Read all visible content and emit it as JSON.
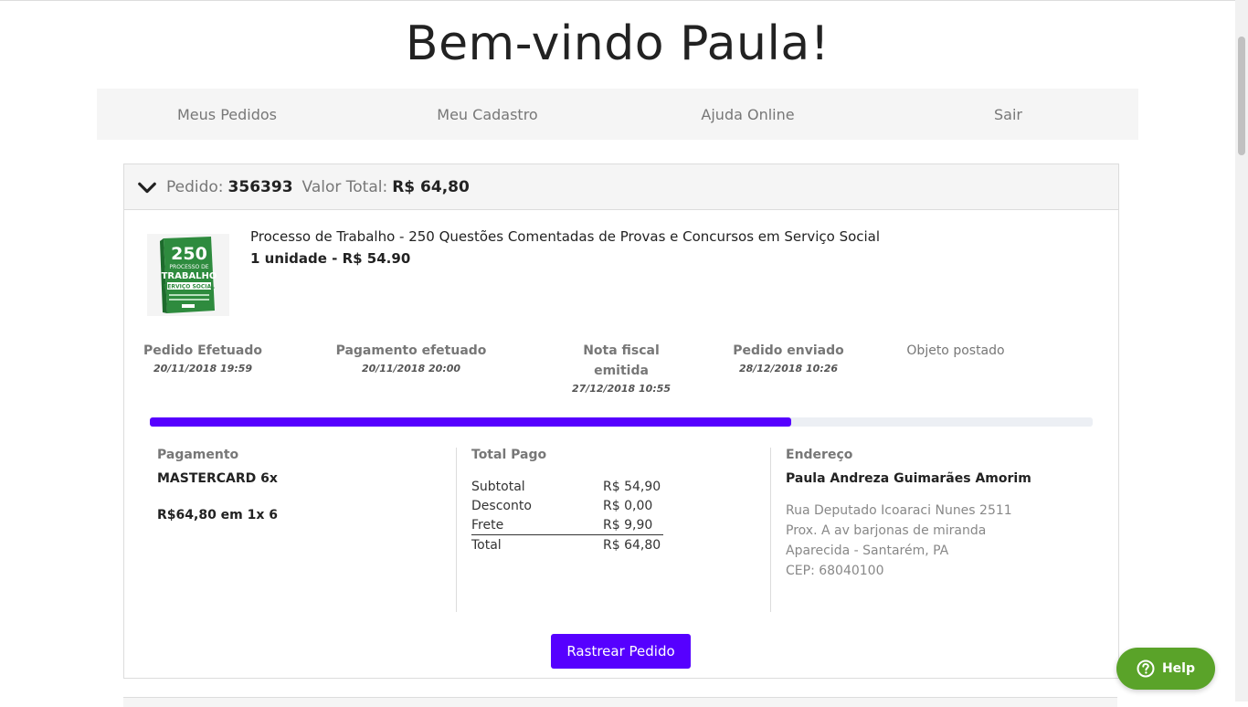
{
  "welcome": "Bem-vindo Paula!",
  "nav": [
    "Meus Pedidos",
    "Meu Cadastro",
    "Ajuda Online",
    "Sair"
  ],
  "order": {
    "label": "Pedido:",
    "number": "356393",
    "total_label": "Valor Total:",
    "total_value": "R$ 64,80",
    "product": {
      "cover_number": "250",
      "cover_text1": "PROCESSO DE",
      "cover_text2": "TRABALHO",
      "cover_text3": "SERVIÇO SOCIAL",
      "title": "Processo de Trabalho - 250 Questões Comentadas de Provas e Concursos em Serviço Social",
      "qty": "1 unidade - R$ 54.90"
    },
    "steps": [
      {
        "title": "Pedido Efetuado",
        "date": "20/11/2018 19:59"
      },
      {
        "title": "Pagamento efetuado",
        "date": "20/11/2018 20:00"
      },
      {
        "title": "Nota fiscal emitida",
        "date": "27/12/2018 10:55"
      },
      {
        "title": "Pedido enviado",
        "date": "28/12/2018 10:26"
      },
      {
        "title": "Objeto postado",
        "date": ""
      }
    ],
    "progress_fraction": 0.68,
    "payment": {
      "title": "Pagamento",
      "method": "MASTERCARD 6x",
      "installments": "R$64,80 em 1x 6"
    },
    "totals": {
      "title": "Total Pago",
      "rows": [
        {
          "label": "Subtotal",
          "value": "R$ 54,90"
        },
        {
          "label": "Desconto",
          "value": "R$ 0,00"
        },
        {
          "label": "Frete",
          "value": "R$ 9,90"
        },
        {
          "label": "Total",
          "value": "R$ 64,80"
        }
      ]
    },
    "address": {
      "title": "Endereço",
      "name": "Paula Andreza Guimarães Amorim",
      "lines": [
        "Rua Deputado Icoaraci Nunes 2511",
        "Prox. A av barjonas de miranda",
        "Aparecida - Santarém, PA",
        "CEP: 68040100"
      ]
    },
    "track_button": "Rastrear Pedido"
  },
  "help": {
    "label": "Help"
  },
  "colors": {
    "accent": "#5600ff",
    "help": "#5aa329",
    "panel": "#f5f5f5"
  }
}
